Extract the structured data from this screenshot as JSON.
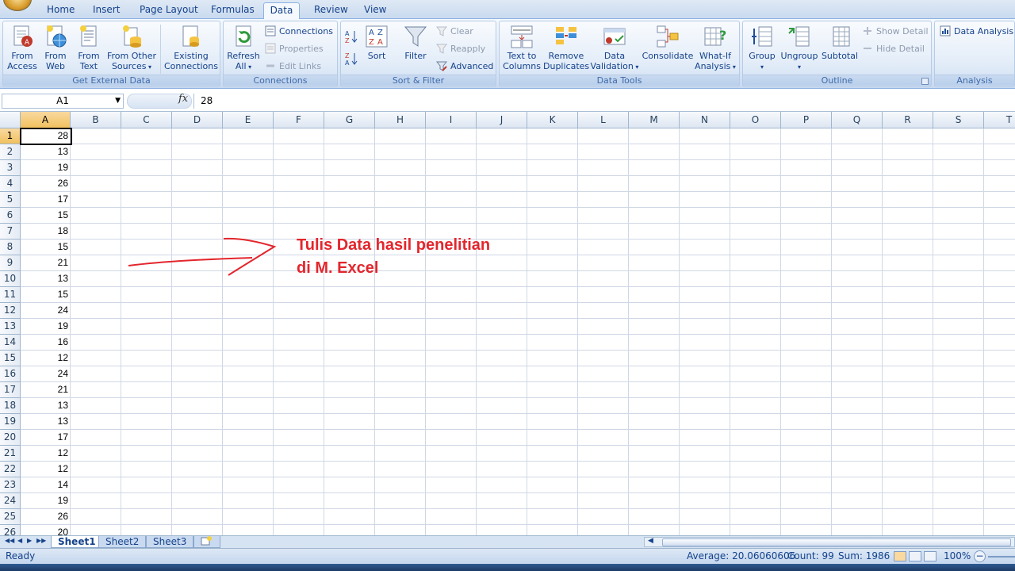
{
  "ribbon_tabs": [
    "Home",
    "Insert",
    "Page Layout",
    "Formulas",
    "Data",
    "Review",
    "View"
  ],
  "active_tab": "Data",
  "groups": {
    "get_external": {
      "label": "Get External Data",
      "buttons": [
        {
          "line1": "From",
          "line2": "Access",
          "icon": "access-db-icon"
        },
        {
          "line1": "From",
          "line2": "Web",
          "icon": "web-globe-icon"
        },
        {
          "line1": "From",
          "line2": "Text",
          "icon": "text-file-icon"
        },
        {
          "line1": "From Other",
          "line2": "Sources",
          "icon": "other-sources-icon"
        },
        {
          "line1": "Existing",
          "line2": "Connections",
          "icon": "existing-connections-icon"
        }
      ]
    },
    "connections": {
      "label": "Connections",
      "refresh_line1": "Refresh",
      "refresh_line2": "All",
      "connections": "Connections",
      "properties": "Properties",
      "edit_links": "Edit Links"
    },
    "sort_filter": {
      "label": "Sort & Filter",
      "sort": "Sort",
      "filter": "Filter",
      "clear": "Clear",
      "reapply": "Reapply",
      "advanced": "Advanced"
    },
    "data_tools": {
      "label": "Data Tools",
      "buttons": [
        {
          "line1": "Text to",
          "line2": "Columns",
          "icon": "text-to-columns-icon"
        },
        {
          "line1": "Remove",
          "line2": "Duplicates",
          "icon": "remove-duplicates-icon"
        },
        {
          "line1": "Data",
          "line2": "Validation",
          "icon": "data-validation-icon"
        },
        {
          "line1": "Consolidate",
          "line2": "",
          "icon": "consolidate-icon"
        },
        {
          "line1": "What-If",
          "line2": "Analysis",
          "icon": "what-if-icon"
        }
      ]
    },
    "outline": {
      "label": "Outline",
      "group": "Group",
      "ungroup": "Ungroup",
      "subtotal": "Subtotal",
      "show_detail": "Show Detail",
      "hide_detail": "Hide Detail"
    },
    "analysis": {
      "label": "Analysis",
      "data_analysis": "Data Analysis"
    }
  },
  "formula_bar": {
    "name_box": "A1",
    "fx": "fx",
    "content": "28"
  },
  "columns": [
    "A",
    "B",
    "C",
    "D",
    "E",
    "F",
    "G",
    "H",
    "I",
    "J",
    "K",
    "L",
    "M",
    "N",
    "O",
    "P",
    "Q",
    "R",
    "S",
    "T"
  ],
  "rows": [
    "1",
    "2",
    "3",
    "4",
    "5",
    "6",
    "7",
    "8",
    "9",
    "10",
    "11",
    "12",
    "13",
    "14",
    "15",
    "16",
    "17",
    "18",
    "19",
    "20",
    "21",
    "22",
    "23",
    "24",
    "25",
    "26"
  ],
  "column_a_values": [
    "28",
    "13",
    "19",
    "26",
    "17",
    "15",
    "18",
    "15",
    "21",
    "13",
    "15",
    "24",
    "19",
    "16",
    "12",
    "24",
    "21",
    "13",
    "13",
    "17",
    "12",
    "12",
    "14",
    "19",
    "26",
    "20"
  ],
  "annotation": {
    "line1": "Tulis Data hasil penelitian",
    "line2": "di M. Excel",
    "color": "#e3262d"
  },
  "sheets": [
    "Sheet1",
    "Sheet2",
    "Sheet3"
  ],
  "active_sheet": "Sheet1",
  "status": {
    "ready": "Ready",
    "average": "Average: 20.06060606",
    "count": "Count: 99",
    "sum": "Sum: 1986",
    "zoom": "100%"
  }
}
